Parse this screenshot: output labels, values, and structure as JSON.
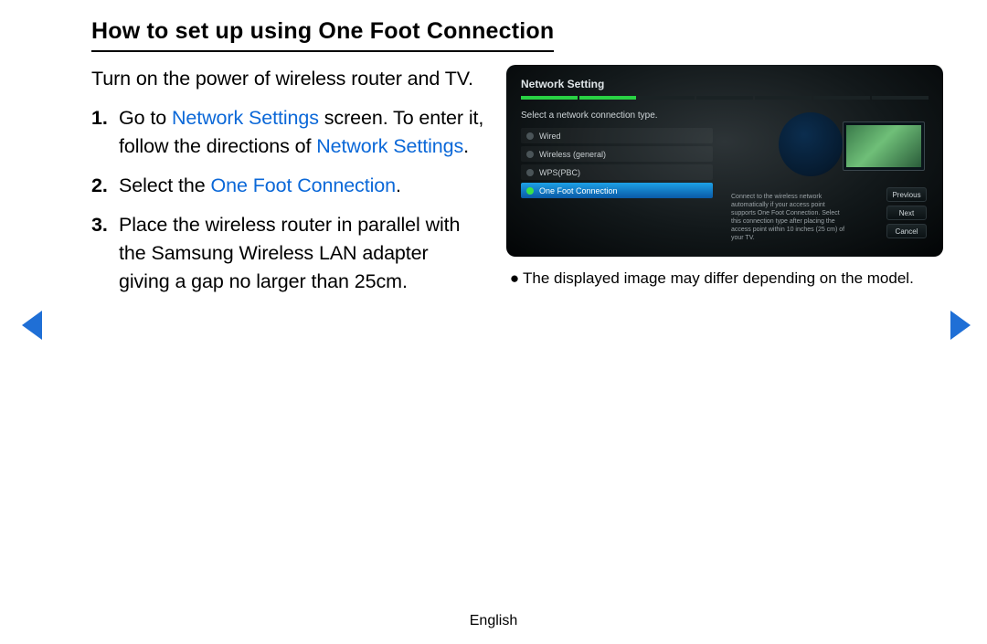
{
  "heading": "How to set up using One Foot Connection",
  "intro": "Turn on the power of wireless router and TV.",
  "steps": {
    "s1_a": "Go to ",
    "s1_link1": "Network Settings",
    "s1_b": " screen. To enter it, follow the directions of ",
    "s1_link2": "Network Settings",
    "s1_c": ".",
    "s2_a": "Select the ",
    "s2_link": "One Foot Connection",
    "s2_b": ".",
    "s3": "Place the wireless router in parallel with the Samsung Wireless LAN adapter giving a gap no larger than 25cm."
  },
  "tv": {
    "title": "Network Setting",
    "prompt": "Select a network connection type.",
    "options": [
      "Wired",
      "Wireless (general)",
      "WPS(PBC)",
      "One Foot Connection"
    ],
    "desc": "Connect to the wireless network automatically if your access point supports One Foot Connection. Select this connection type after placing the access point within 10 inches (25 cm) of your TV.",
    "buttons": [
      "Previous",
      "Next",
      "Cancel"
    ]
  },
  "caption": "The displayed image may differ depending on the model.",
  "footer": "English"
}
